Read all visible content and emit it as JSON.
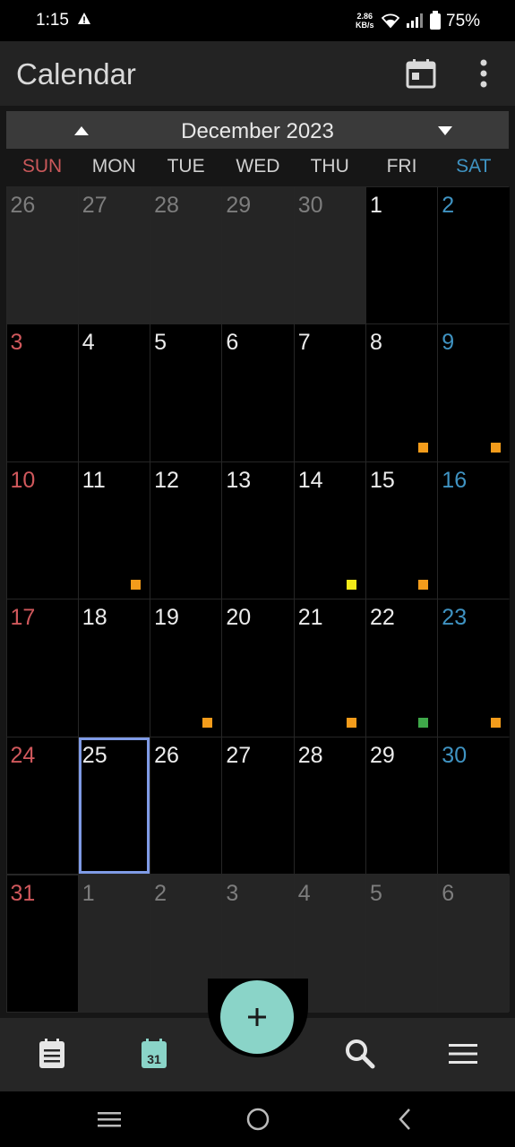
{
  "status": {
    "time": "1:15",
    "speed_line1": "2.86",
    "speed_line2": "KB/s",
    "battery": "75%"
  },
  "app_bar": {
    "title": "Calendar"
  },
  "month": {
    "label": "December 2023"
  },
  "weekdays": [
    "SUN",
    "MON",
    "TUE",
    "WED",
    "THU",
    "FRI",
    "SAT"
  ],
  "weeks": [
    [
      {
        "day": "26",
        "cur": false
      },
      {
        "day": "27",
        "cur": false
      },
      {
        "day": "28",
        "cur": false
      },
      {
        "day": "29",
        "cur": false
      },
      {
        "day": "30",
        "cur": false
      },
      {
        "day": "1",
        "cur": true
      },
      {
        "day": "2",
        "cur": true
      }
    ],
    [
      {
        "day": "3",
        "cur": true
      },
      {
        "day": "4",
        "cur": true
      },
      {
        "day": "5",
        "cur": true
      },
      {
        "day": "6",
        "cur": true
      },
      {
        "day": "7",
        "cur": true
      },
      {
        "day": "8",
        "cur": true,
        "event": "#f39c1b"
      },
      {
        "day": "9",
        "cur": true,
        "event": "#f39c1b"
      }
    ],
    [
      {
        "day": "10",
        "cur": true
      },
      {
        "day": "11",
        "cur": true,
        "event": "#f39c1b"
      },
      {
        "day": "12",
        "cur": true
      },
      {
        "day": "13",
        "cur": true
      },
      {
        "day": "14",
        "cur": true,
        "event": "#f2ea18"
      },
      {
        "day": "15",
        "cur": true,
        "event": "#f39c1b"
      },
      {
        "day": "16",
        "cur": true
      }
    ],
    [
      {
        "day": "17",
        "cur": true
      },
      {
        "day": "18",
        "cur": true
      },
      {
        "day": "19",
        "cur": true,
        "event": "#f39c1b"
      },
      {
        "day": "20",
        "cur": true
      },
      {
        "day": "21",
        "cur": true,
        "event": "#f39c1b"
      },
      {
        "day": "22",
        "cur": true,
        "event": "#3fa84a"
      },
      {
        "day": "23",
        "cur": true,
        "event": "#f39c1b"
      }
    ],
    [
      {
        "day": "24",
        "cur": true
      },
      {
        "day": "25",
        "cur": true,
        "selected": true
      },
      {
        "day": "26",
        "cur": true
      },
      {
        "day": "27",
        "cur": true
      },
      {
        "day": "28",
        "cur": true
      },
      {
        "day": "29",
        "cur": true
      },
      {
        "day": "30",
        "cur": true
      }
    ],
    [
      {
        "day": "31",
        "cur": true
      },
      {
        "day": "1",
        "cur": false
      },
      {
        "day": "2",
        "cur": false
      },
      {
        "day": "3",
        "cur": false
      },
      {
        "day": "4",
        "cur": false
      },
      {
        "day": "5",
        "cur": false
      },
      {
        "day": "6",
        "cur": false
      }
    ]
  ],
  "bottom_nav": {
    "items": [
      {
        "name": "list-view-icon"
      },
      {
        "name": "calendar-month-view-icon",
        "badge": "31"
      },
      {
        "name": "search-icon"
      },
      {
        "name": "menu-icon"
      }
    ]
  },
  "colors": {
    "accent": "#8ad4c8",
    "sunday": "#d0585c",
    "saturday": "#3f93c2",
    "selected": "#7f9be6"
  }
}
